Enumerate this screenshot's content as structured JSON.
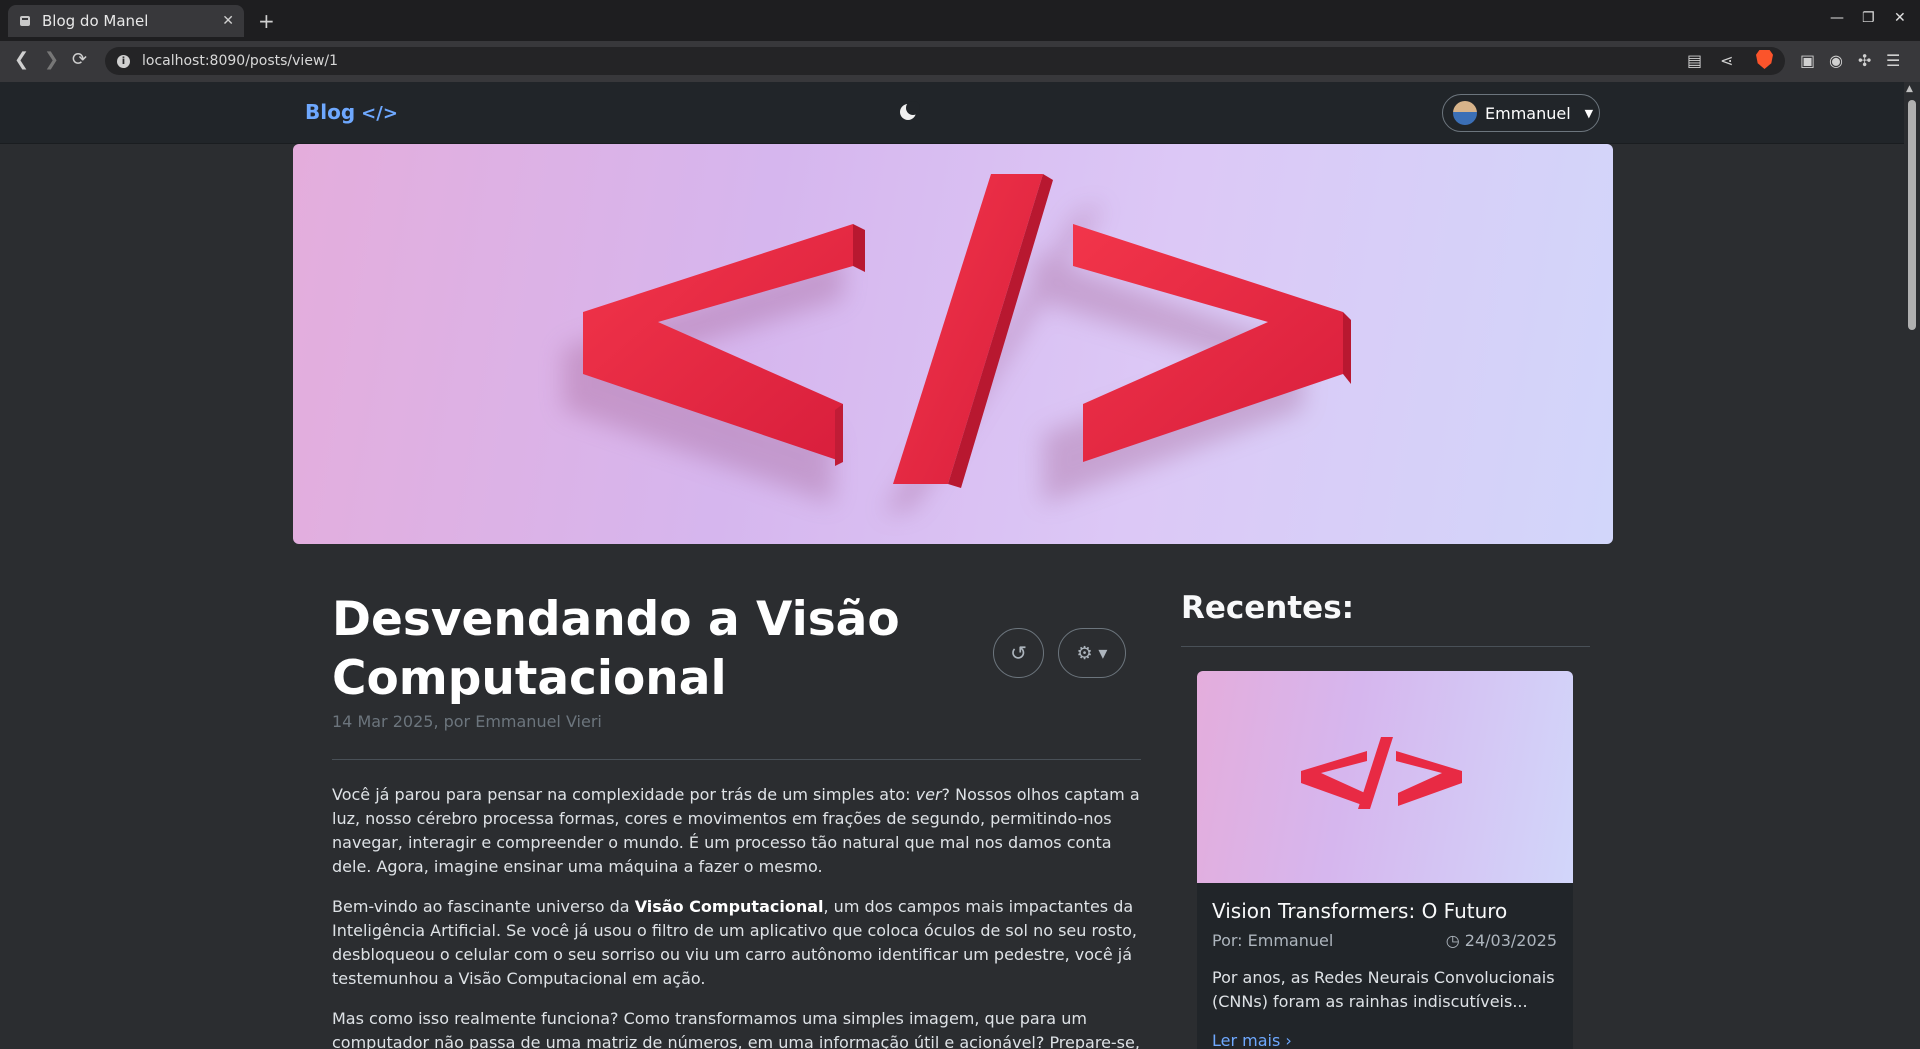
{
  "browser": {
    "tab_title": "Blog do Manel",
    "tab_close": "✕",
    "new_tab": "+",
    "url": "localhost:8090/posts/view/1",
    "win_min": "—",
    "win_max": "❐",
    "win_close": "✕",
    "back": "❮",
    "forward": "❯",
    "reload": "⟳"
  },
  "site": {
    "brand": "Blog",
    "brand_icon": "</>",
    "user_name": "Emmanuel",
    "user_chevron": "⌄"
  },
  "post": {
    "title": "Desvendando a Visão Computacional",
    "meta": "14 Mar 2025, por Emmanuel Vieri",
    "back_icon": "↺",
    "gear_icon": "⚙ ▾",
    "p1_a": "Você já parou para pensar na complexidade por trás de um simples ato: ",
    "p1_em": "ver",
    "p1_b": "? Nossos olhos captam a luz, nosso cérebro processa formas, cores e movimentos em frações de segundo, permitindo-nos navegar, interagir e compreender o mundo. É um processo tão natural que mal nos damos conta dele. Agora, imagine ensinar uma máquina a fazer o mesmo.",
    "p2_a": "Bem-vindo ao fascinante universo da ",
    "p2_b": "Visão Computacional",
    "p2_c": ", um dos campos mais impactantes da Inteligência Artificial. Se você já usou o filtro de um aplicativo que coloca óculos de sol no seu rosto, desbloqueou o celular com o seu sorriso ou viu um carro autônomo identificar um pedestre, você já testemunhou a Visão Computacional em ação.",
    "p3": "Mas como isso realmente funciona? Como transformamos uma simples imagem, que para um computador não passa de uma matriz de números, em uma informação útil e acionável? Prepare-se, pois nesta aula completa"
  },
  "sidebar": {
    "title": "Recentes:",
    "card_title": "Vision Transformers: O Futuro",
    "card_author": "Por: Emmanuel",
    "card_date": "24/03/2025",
    "card_clock": "◷",
    "card_text": "Por anos, as Redes Neurais Convolucionais (CNNs) foram as rainhas indiscutíveis...",
    "card_link": "Ler mais",
    "card_link_icon": "›"
  }
}
